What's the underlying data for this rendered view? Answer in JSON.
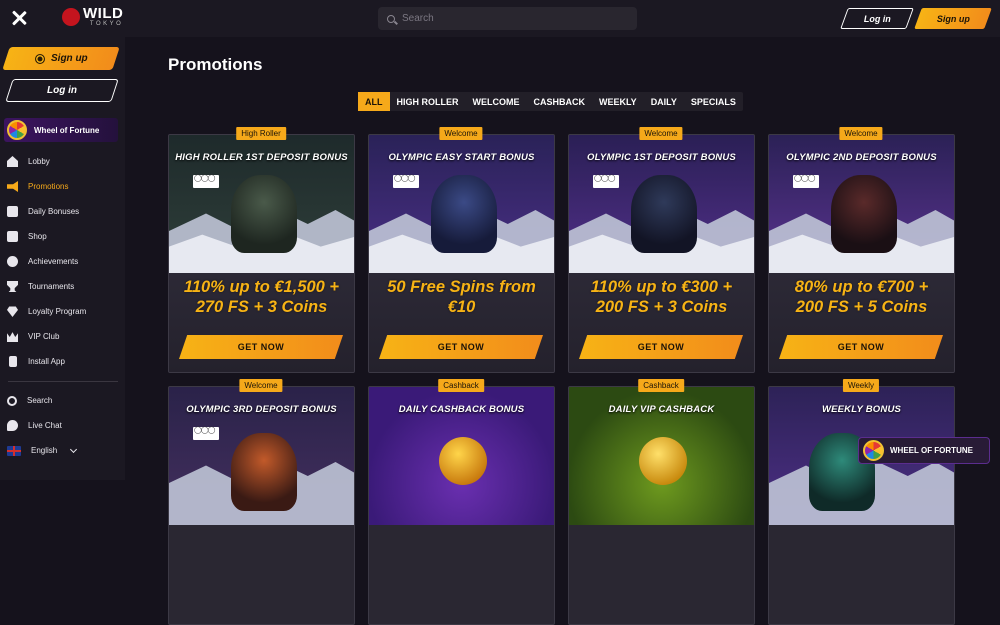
{
  "header": {
    "logo_main": "WILD",
    "logo_sub": "TOKYO",
    "search_placeholder": "Search",
    "login_label": "Log in",
    "signup_label": "Sign up"
  },
  "sidebar": {
    "signup_label": "Sign up",
    "login_label": "Log in",
    "wheel_label": "Wheel of Fortune",
    "nav": [
      {
        "label": "Lobby",
        "icon": "home-icon"
      },
      {
        "label": "Promotions",
        "icon": "megaphone-icon",
        "active": true
      },
      {
        "label": "Daily Bonuses",
        "icon": "gift-icon"
      },
      {
        "label": "Shop",
        "icon": "shop-icon"
      },
      {
        "label": "Achievements",
        "icon": "medal-icon"
      },
      {
        "label": "Tournaments",
        "icon": "trophy-icon"
      },
      {
        "label": "Loyalty Program",
        "icon": "diamond-icon"
      },
      {
        "label": "VIP Club",
        "icon": "crown-icon"
      },
      {
        "label": "Install App",
        "icon": "phone-icon"
      }
    ],
    "bottom": {
      "search": "Search",
      "live_chat": "Live Chat",
      "language": "English"
    }
  },
  "main": {
    "title": "Promotions",
    "filters": [
      "ALL",
      "HIGH ROLLER",
      "WELCOME",
      "CASHBACK",
      "WEEKLY",
      "DAILY",
      "SPECIALS"
    ],
    "active_filter": "ALL",
    "cards": [
      {
        "badge": "High Roller",
        "title": "HIGH ROLLER 1ST DEPOSIT BONUS",
        "offer_line1": "110% up to €1,500 +",
        "offer_line2": "270 FS + 3 Coins",
        "cta": "GET NOW"
      },
      {
        "badge": "Welcome",
        "title": "OLYMPIC EASY START BONUS",
        "offer_line1": "50 Free Spins from",
        "offer_line2": "€10",
        "cta": "GET NOW"
      },
      {
        "badge": "Welcome",
        "title": "OLYMPIC 1ST DEPOSIT BONUS",
        "offer_line1": "110% up to €300 +",
        "offer_line2": "200 FS + 3 Coins",
        "cta": "GET NOW"
      },
      {
        "badge": "Welcome",
        "title": "OLYMPIC 2ND DEPOSIT BONUS",
        "offer_line1": "80% up to €700 +",
        "offer_line2": "200 FS + 5 Coins",
        "cta": "GET NOW"
      },
      {
        "badge": "Welcome",
        "title": "OLYMPIC 3RD DEPOSIT BONUS"
      },
      {
        "badge": "Cashback",
        "title": "DAILY CASHBACK BONUS"
      },
      {
        "badge": "Cashback",
        "title": "DAILY VIP CASHBACK"
      },
      {
        "badge": "Weekly",
        "title": "WEEKLY BONUS"
      }
    ]
  },
  "floating": {
    "wheel_label": "WHEEL OF FORTUNE"
  },
  "colors": {
    "accent": "#f6a91a",
    "accent_gradient_end": "#f28c1b",
    "background": "#15121c",
    "panel": "#1b1822",
    "brand_red": "#c4141e"
  }
}
